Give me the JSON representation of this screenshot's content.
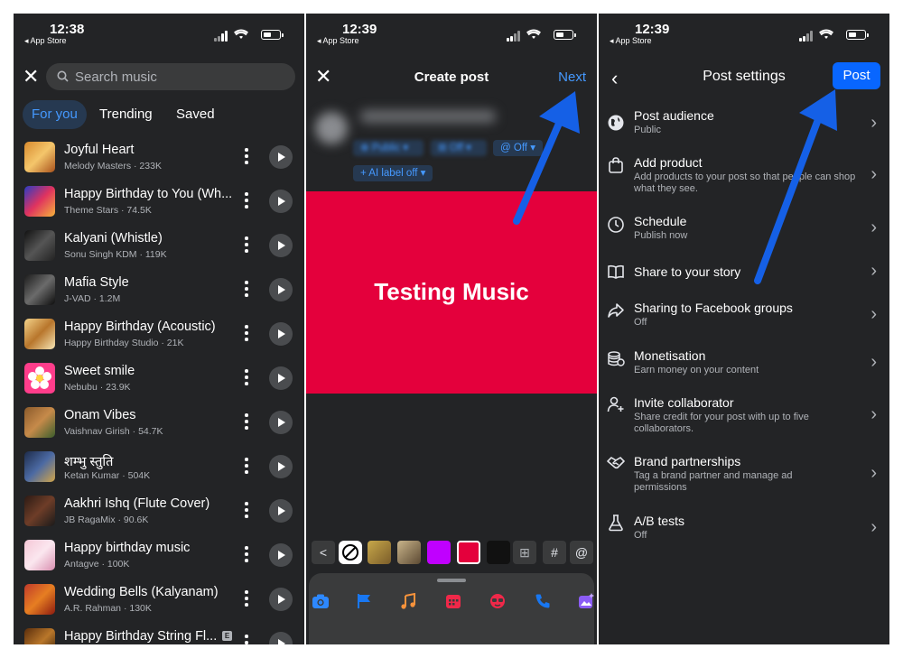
{
  "accent_blue": "#0866ff",
  "link_blue": "#4599ff",
  "canvas_color": "#e4003c",
  "music_panel": {
    "status": {
      "time": "12:38",
      "back_label": "◂ App Store"
    },
    "search": {
      "placeholder": "Search music"
    },
    "tabs": [
      "For you",
      "Trending",
      "Saved"
    ],
    "songs": [
      {
        "title": "Joyful Heart",
        "subtitle": "Melody Masters · 233K"
      },
      {
        "title": "Happy Birthday to You (Wh...",
        "subtitle": "Theme Stars · 74.5K"
      },
      {
        "title": "Kalyani (Whistle)",
        "subtitle": "Sonu Singh KDM · 119K"
      },
      {
        "title": "Mafia Style",
        "subtitle": "J-VAD · 1.2M"
      },
      {
        "title": "Happy Birthday (Acoustic)",
        "subtitle": "Happy Birthday Studio · 21K"
      },
      {
        "title": "Sweet smile",
        "subtitle": "Nebubu · 23.9K"
      },
      {
        "title": "Onam Vibes",
        "subtitle": "Vaishnav Girish · 54.7K"
      },
      {
        "title": "शम्भु स्तुति",
        "subtitle": "Ketan Kumar · 504K"
      },
      {
        "title": "Aakhri Ishq (Flute Cover)",
        "subtitle": "JB RagaMix · 90.6K"
      },
      {
        "title": "Happy birthday music",
        "subtitle": "Antagve · 100K"
      },
      {
        "title": "Wedding Bells (Kalyanam)",
        "subtitle": "A.R. Rahman · 130K"
      },
      {
        "title": "Happy Birthday String Fl...",
        "subtitle": "",
        "explicit": "E"
      }
    ]
  },
  "create_panel": {
    "status": {
      "time": "12:39",
      "back_label": "◂ App Store"
    },
    "title": "Create post",
    "next_label": "Next",
    "pills": {
      "audience": "Public",
      "album": "Off",
      "threads": "Off",
      "ai_label": "AI label off"
    },
    "canvas_text": "Testing Music",
    "tool_glyphs": {
      "back": "<",
      "grid": "⊞",
      "hashtag": "#",
      "mention": "@"
    }
  },
  "settings_panel": {
    "status": {
      "time": "12:39",
      "back_label": "◂ App Store"
    },
    "title": "Post settings",
    "post_label": "Post",
    "items": [
      {
        "title": "Post audience",
        "subtitle": "Public",
        "icon": "globe-icon"
      },
      {
        "title": "Add product",
        "subtitle": "Add products to your post so that people can shop what they see.",
        "icon": "shopping-bag-icon"
      },
      {
        "title": "Schedule",
        "subtitle": "Publish now",
        "icon": "clock-icon"
      },
      {
        "title": "Share to your story",
        "subtitle": "",
        "icon": "book-icon"
      },
      {
        "title": "Sharing to Facebook groups",
        "subtitle": "Off",
        "icon": "share-icon"
      },
      {
        "title": "Monetisation",
        "subtitle": "Earn money on your content",
        "icon": "coins-icon"
      },
      {
        "title": "Invite collaborator",
        "subtitle": "Share credit for your post with up to five collaborators.",
        "icon": "add-person-icon"
      },
      {
        "title": "Brand partnerships",
        "subtitle": "Tag a brand partner and manage ad permissions",
        "icon": "handshake-icon"
      },
      {
        "title": "A/B tests",
        "subtitle": "Off",
        "icon": "flask-icon"
      }
    ]
  }
}
